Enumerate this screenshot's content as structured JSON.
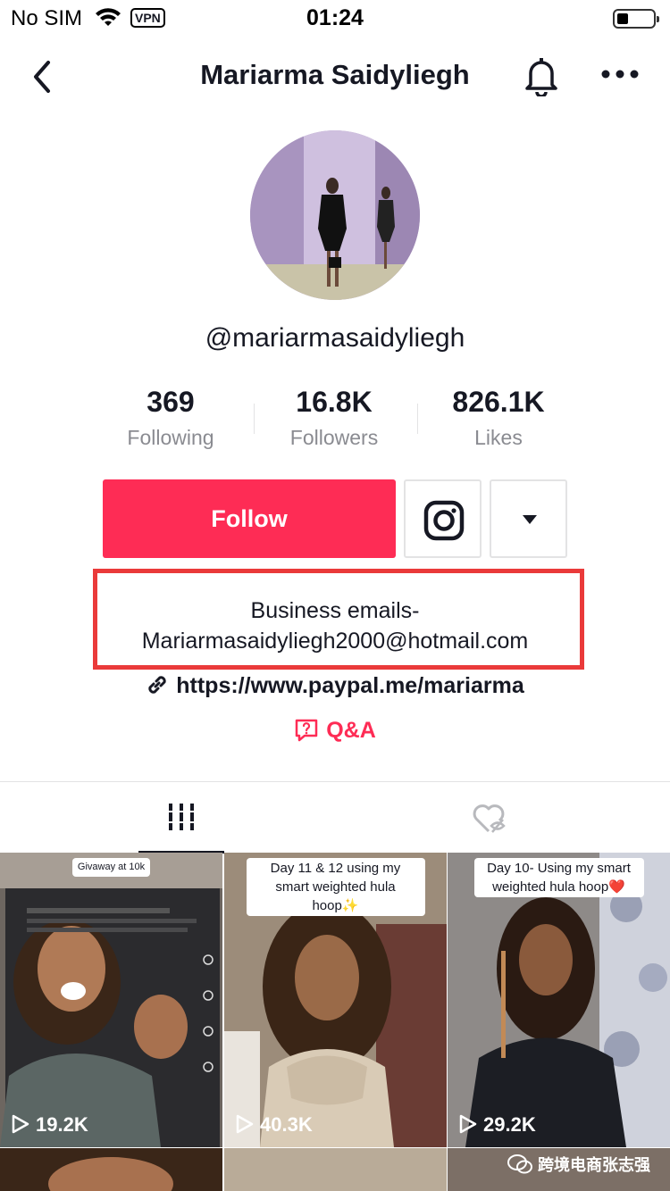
{
  "status_bar": {
    "carrier": "No SIM",
    "vpn": "VPN",
    "time": "01:24"
  },
  "nav": {
    "title": "Mariarma Saidyliegh"
  },
  "profile": {
    "username": "@mariarmasaidyliegh"
  },
  "stats": [
    {
      "value": "369",
      "label": "Following"
    },
    {
      "value": "16.8K",
      "label": "Followers"
    },
    {
      "value": "826.1K",
      "label": "Likes"
    }
  ],
  "actions": {
    "follow_label": "Follow"
  },
  "bio": {
    "line1": "Business emails-",
    "line2": "Mariarmasaidyliegh2000@hotmail.com"
  },
  "link": {
    "url": "https://www.paypal.me/mariarma"
  },
  "qa": {
    "label": "Q&A"
  },
  "videos": [
    {
      "caption": "Givaway at 10k",
      "views": "19.2K"
    },
    {
      "caption": "Day 11 & 12 using my smart weighted hula hoop✨",
      "views": "40.3K"
    },
    {
      "caption": "Day 10- Using my smart weighted hula hoop❤️",
      "views": "29.2K"
    }
  ],
  "watermark": {
    "text": "跨境电商张志强"
  },
  "colors": {
    "accent": "#fe2c55",
    "highlight_box": "#ea3a3a",
    "text": "#161823",
    "muted": "#8a8b91"
  }
}
